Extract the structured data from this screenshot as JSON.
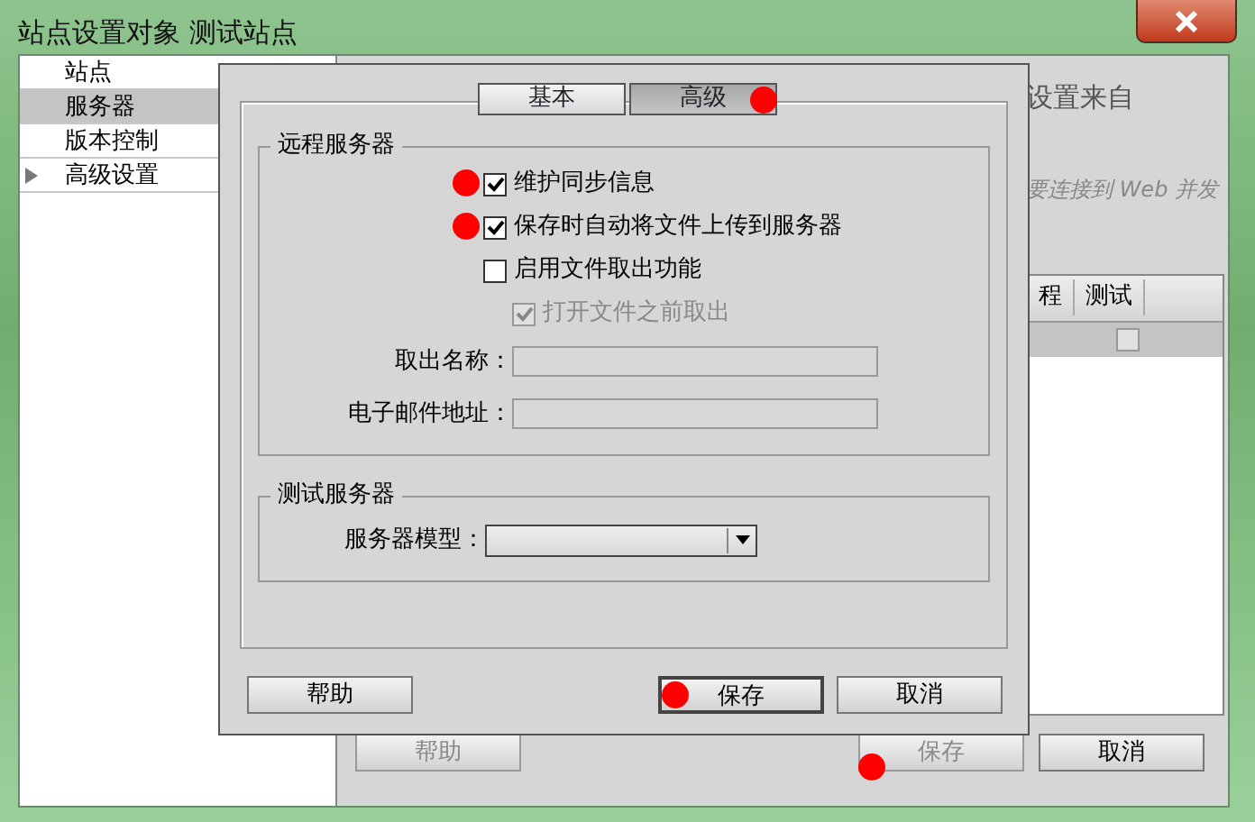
{
  "window": {
    "title": "站点设置对象 测试站点"
  },
  "sidebar": {
    "items": [
      {
        "label": "站点",
        "selected": false,
        "expandable": false
      },
      {
        "label": "服务器",
        "selected": true,
        "expandable": false
      },
      {
        "label": "版本控制",
        "selected": false,
        "expandable": false
      },
      {
        "label": "高级设置",
        "selected": false,
        "expandable": true
      }
    ]
  },
  "background_panel": {
    "heading": "设置来自",
    "note": "要连接到 Web 并发",
    "table": {
      "columns": [
        "程",
        "测试"
      ],
      "rows": [
        {
          "checked": false
        }
      ]
    },
    "buttons": [
      {
        "label": "帮助",
        "disabled": true,
        "marked": false
      },
      {
        "label": "保存",
        "disabled": true,
        "marked": true
      },
      {
        "label": "取消",
        "disabled": false,
        "marked": false
      }
    ]
  },
  "dialog": {
    "tabs": [
      {
        "label": "基本",
        "selected": false,
        "marked": false
      },
      {
        "label": "高级",
        "selected": true,
        "marked": true
      }
    ],
    "remote_server": {
      "legend": "远程服务器",
      "options": [
        {
          "label": "维护同步信息",
          "checked": true,
          "disabled": false,
          "marked": true
        },
        {
          "label": "保存时自动将文件上传到服务器",
          "checked": true,
          "disabled": false,
          "marked": true
        },
        {
          "label": "启用文件取出功能",
          "checked": false,
          "disabled": false,
          "marked": false,
          "children": [
            {
              "label": "打开文件之前取出",
              "checked": true,
              "disabled": true
            }
          ]
        }
      ],
      "fields": [
        {
          "label": "取出名称：",
          "disabled": true
        },
        {
          "label": "电子邮件地址：",
          "disabled": true
        }
      ]
    },
    "testing_server": {
      "legend": "测试服务器",
      "select_label": "服务器模型："
    },
    "buttons": [
      {
        "label": "帮助",
        "default": false,
        "marked": false
      },
      {
        "label": "保存",
        "default": true,
        "marked": true
      },
      {
        "label": "取消",
        "default": false,
        "marked": false
      }
    ]
  }
}
